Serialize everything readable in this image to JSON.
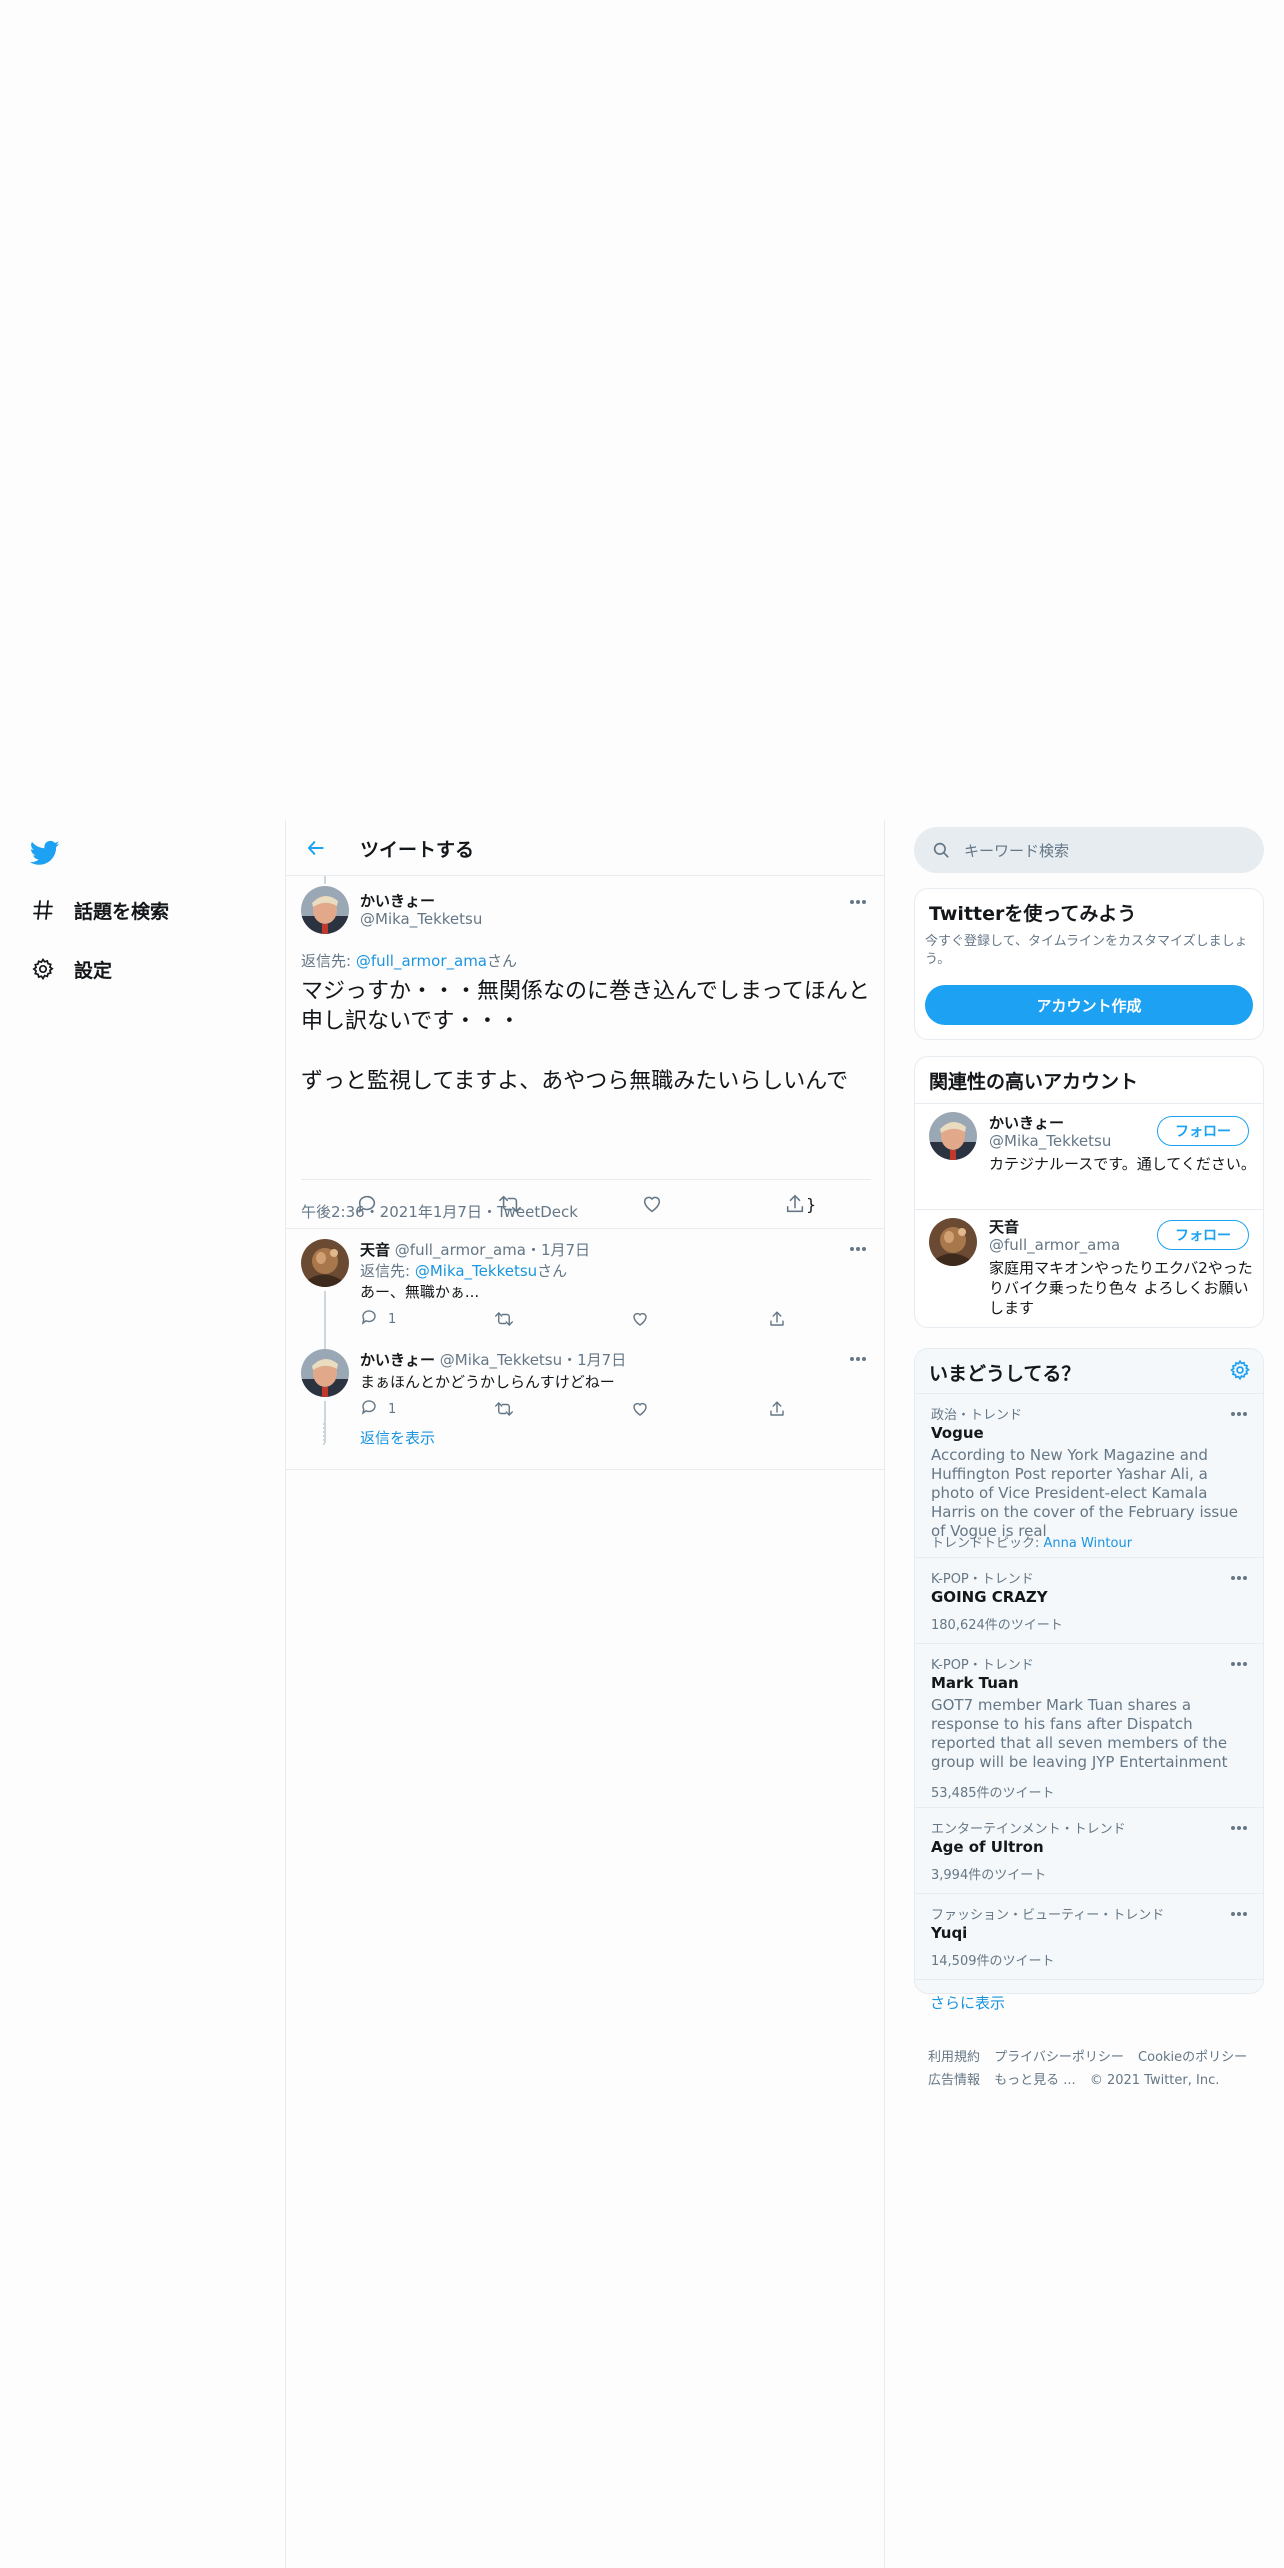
{
  "nav": {
    "logo_icon": "twitter-bird-icon",
    "items": [
      {
        "label": "話題を検索",
        "icon": "hashtag-icon"
      },
      {
        "label": "設定",
        "icon": "gear-icon"
      }
    ]
  },
  "header": {
    "back_icon": "back-arrow-icon",
    "title": "ツイートする"
  },
  "tweet": {
    "name": "かいきょー",
    "handle": "@Mika_Tekketsu",
    "reply_prefix": "返信先: ",
    "reply_to": "@full_armor_ama",
    "reply_suffix": "さん",
    "text_line1": "マジっすか・・・無関係なのに巻き込んでしまってほんと申し訳ないです・・・",
    "text_line2": "ずっと監視してますよ、あやつら無職みたいらしいんで",
    "meta": "午後2:36・2021年1月7日・TweetDeck"
  },
  "replies": [
    {
      "name": "天音",
      "handle": "@full_armor_ama",
      "date": "・1月7日",
      "reply_prefix": "返信先: ",
      "reply_to": "@Mika_Tekketsu",
      "reply_suffix": "さん",
      "text": "あー、無職かぁ...",
      "reply_count": "1"
    },
    {
      "name": "かいきょー",
      "handle": "@Mika_Tekketsu",
      "date": "・1月7日",
      "text": "まぁほんとかどうかしらんすけどねー",
      "reply_count": "1"
    }
  ],
  "show_replies": "返信を表示",
  "search": {
    "placeholder": "キーワード検索"
  },
  "signup": {
    "title": "Twitterを使ってみよう",
    "desc": "今すぐ登録して、タイムラインをカスタマイズしましょう。",
    "button": "アカウント作成"
  },
  "related": {
    "title": "関連性の高いアカウント",
    "accounts": [
      {
        "name": "かいきょー",
        "handle": "@Mika_Tekketsu",
        "bio": "カテジナルースです。通してください。",
        "follow": "フォロー"
      },
      {
        "name": "天音",
        "handle": "@full_armor_ama",
        "bio": "家庭用マキオンやったりエクバ2やったりバイク乗ったり色々 よろしくお願いします",
        "follow": "フォロー"
      }
    ]
  },
  "trends": {
    "title": "いまどうしてる？",
    "items": [
      {
        "category": "政治・トレンド",
        "name": "Vogue",
        "desc": "According to New York Magazine and Huffington Post reporter Yashar Ali, a photo of Vice President-elect Kamala Harris on the cover of the February issue of Vogue is real",
        "topic_prefix": "トレンドトピック: ",
        "topic": "Anna Wintour"
      },
      {
        "category": "K-POP・トレンド",
        "name": "GOING CRAZY",
        "count": "180,624件のツイート"
      },
      {
        "category": "K-POP・トレンド",
        "name": "Mark Tuan",
        "desc": "GOT7 member Mark Tuan shares a response to his fans after Dispatch reported that all seven members of the group will be leaving JYP Entertainment",
        "count": "53,485件のツイート"
      },
      {
        "category": "エンターテインメント・トレンド",
        "name": "Age of Ultron",
        "count": "3,994件のツイート"
      },
      {
        "category": "ファッション・ビューティー・トレンド",
        "name": "Yuqi",
        "count": "14,509件のツイート"
      }
    ],
    "show_more": "さらに表示"
  },
  "footer": {
    "line1": [
      "利用規約",
      "プライバシーポリシー",
      "Cookieのポリシー"
    ],
    "line2": [
      "広告情報",
      "もっと見る ...",
      "© 2021 Twitter, Inc."
    ]
  },
  "colors": {
    "accent": "#1da1f2",
    "link": "#1b95e0",
    "muted": "#657786",
    "border": "#e6ecf0"
  }
}
